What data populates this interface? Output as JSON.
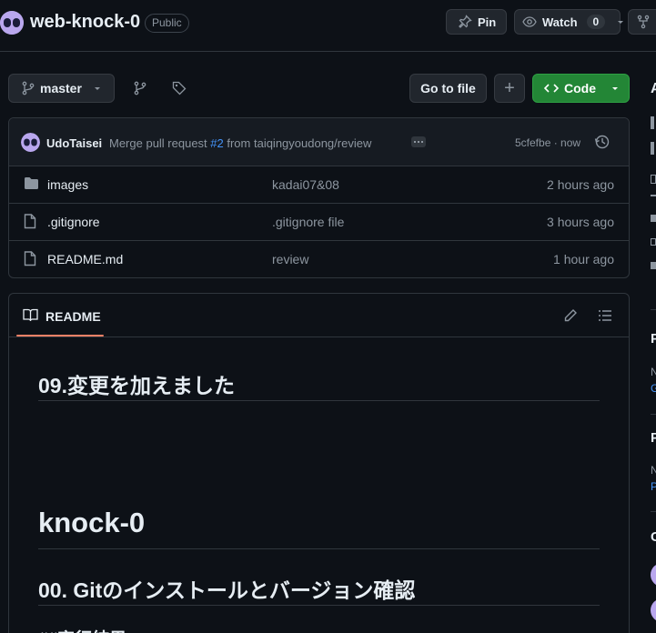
{
  "repo": {
    "name": "web-knock-0",
    "visibility": "Public"
  },
  "header_actions": {
    "pin_label": "Pin",
    "watch_label": "Watch",
    "watch_count": "0"
  },
  "toolbar": {
    "branch": "master",
    "go_to_file": "Go to file",
    "add_label": "+",
    "code_label": "Code"
  },
  "latest_commit": {
    "author": "UdoTaisei",
    "message_prefix": "Merge pull request ",
    "pr_link": "#2",
    "message_suffix": " from taiqingyoudong/review",
    "hash_time": "5cfefbe · now"
  },
  "files": [
    {
      "type": "folder",
      "name": "images",
      "message": "kadai07&08",
      "time": "2 hours ago"
    },
    {
      "type": "file",
      "name": ".gitignore",
      "message": ".gitignore file",
      "time": "3 hours ago"
    },
    {
      "type": "file",
      "name": "README.md",
      "message": "review",
      "time": "1 hour ago"
    }
  ],
  "readme": {
    "tab_label": "README",
    "h_change": "09.変更を加えました",
    "h_title": "knock-0",
    "h_git": "00. Gitのインストールとバージョン確認",
    "partial_next": "##実行結果"
  },
  "sidebar_partial": {
    "a": "A",
    "p1": "P",
    "p2": "P",
    "c": "C",
    "n1": "N",
    "g": "G",
    "n2": "N",
    "p3": "P"
  },
  "colors": {
    "background": "#0d1117",
    "code_button": "#238636",
    "link": "#4493f8",
    "accent_underline": "#f78166"
  }
}
